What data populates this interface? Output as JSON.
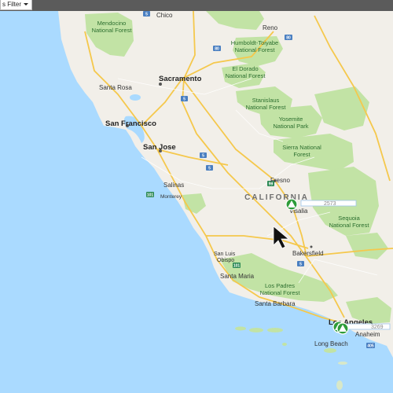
{
  "toolbar": {
    "filter_label": "s Filter"
  },
  "map": {
    "state_label": "CALIFORNIA",
    "colors": {
      "ocean": "#aadaff",
      "land": "#f2efe9",
      "park": "#c2e3a5",
      "highway": "#f5c84c",
      "road": "#ffffff"
    },
    "cities": [
      {
        "id": "chico",
        "name": "Chico"
      },
      {
        "id": "reno",
        "name": "Reno"
      },
      {
        "id": "santa-rosa",
        "name": "Santa Rosa"
      },
      {
        "id": "sacramento",
        "name": "Sacramento"
      },
      {
        "id": "san-francisco",
        "name": "San Francisco"
      },
      {
        "id": "san-jose",
        "name": "San Jose"
      },
      {
        "id": "salinas",
        "name": "Salinas"
      },
      {
        "id": "monterey",
        "name": "Monterey"
      },
      {
        "id": "fresno",
        "name": "Fresno"
      },
      {
        "id": "visalia",
        "name": "Visalia"
      },
      {
        "id": "bakersfield",
        "name": "Bakersfield"
      },
      {
        "id": "san-luis-obispo-1",
        "name": "San Luis"
      },
      {
        "id": "san-luis-obispo-2",
        "name": "Obispo"
      },
      {
        "id": "santa-maria",
        "name": "Santa Maria"
      },
      {
        "id": "santa-barbara",
        "name": "Santa Barbara"
      },
      {
        "id": "los-angeles",
        "name": "Los Angeles"
      },
      {
        "id": "anaheim",
        "name": "Anaheim"
      },
      {
        "id": "long-beach",
        "name": "Long Beach"
      }
    ],
    "parks": [
      {
        "id": "mendocino",
        "lines": [
          "Mendocino",
          "National Forest"
        ]
      },
      {
        "id": "humboldt",
        "lines": [
          "Humboldt-Toiyabe",
          "National Forest"
        ]
      },
      {
        "id": "eldorado",
        "lines": [
          "El Dorado",
          "National Forest"
        ]
      },
      {
        "id": "stanislaus",
        "lines": [
          "Stanislaus",
          "National Forest"
        ]
      },
      {
        "id": "yosemite",
        "lines": [
          "Yosemite",
          "National Park"
        ]
      },
      {
        "id": "sierra",
        "lines": [
          "Sierra National",
          "Forest"
        ]
      },
      {
        "id": "sequoia",
        "lines": [
          "Sequoia",
          "National Forest"
        ]
      },
      {
        "id": "los-padres",
        "lines": [
          "Los Padres",
          "National Forest"
        ]
      }
    ],
    "markers": [
      {
        "id": "visalia-marker",
        "label": "2573"
      },
      {
        "id": "la-marker",
        "label": "3269"
      }
    ],
    "shields": [
      "5",
      "80",
      "5",
      "80",
      "5",
      "101",
      "5",
      "99",
      "101",
      "5",
      "405"
    ]
  }
}
